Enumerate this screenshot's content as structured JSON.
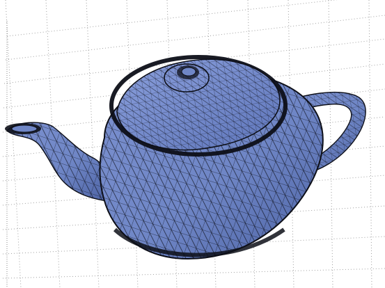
{
  "scene": {
    "object": "teapot",
    "render_style": "wireframe-over-shaded-surface",
    "surface_color": "#6f86c6",
    "surface_shadow_color": "#4d63a4",
    "wire_color": "#0d0f18",
    "grid_color": "#9a9a9a",
    "background_color": "#ffffff"
  }
}
